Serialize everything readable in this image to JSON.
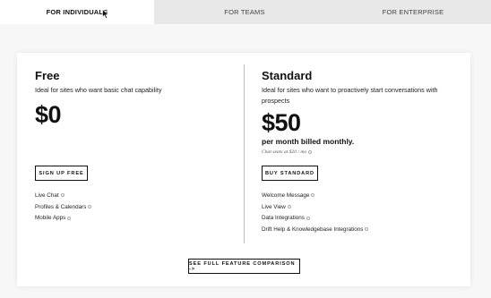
{
  "tabs": {
    "individuals": "FOR INDIVIDUALS",
    "teams": "FOR TEAMS",
    "enterprise": "FOR ENTERPRISE"
  },
  "plans": {
    "free": {
      "name": "Free",
      "description": "Ideal for sites who want basic chat capability",
      "price": "$0",
      "cta": "SIGN UP FREE",
      "features": [
        "Live Chat",
        "Profiles & Calendars",
        "Mobile Apps"
      ]
    },
    "standard": {
      "name": "Standard",
      "description": "Ideal for sites who want to proactively start conversations with prospects",
      "price": "$50",
      "billing": "per month billed monthly.",
      "seats": "Chat seats at $20 / mo",
      "cta": "BUY STANDARD",
      "features": [
        "Welcome Message",
        "Live View",
        "Data Integrations",
        "Drift Help & Knowledgebase Integrations"
      ]
    }
  },
  "compare": {
    "label": "SEE FULL FEATURE COMPARISON ->"
  },
  "colors": {
    "tab_inactive": "#e8e8e8",
    "background": "#f7f7f7",
    "text": "#111111"
  }
}
